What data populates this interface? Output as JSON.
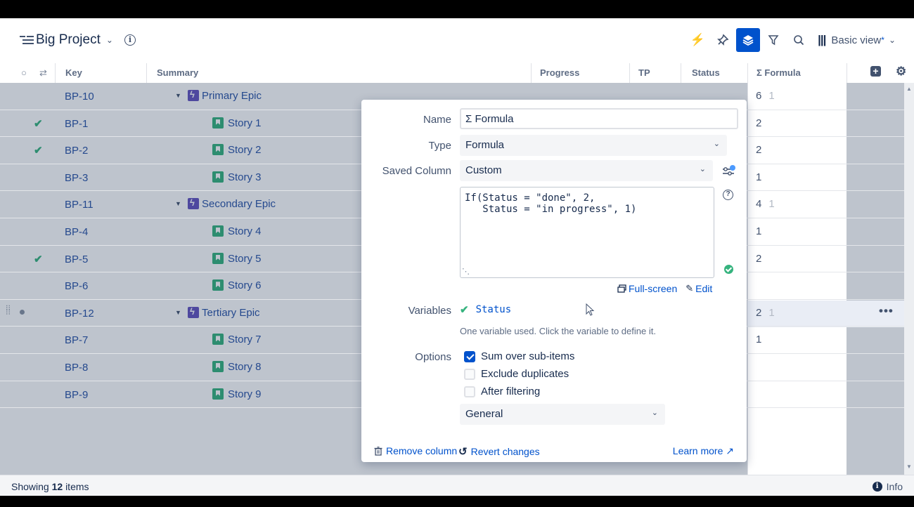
{
  "header": {
    "project_name": "Big Project",
    "view_name": "Basic view",
    "view_modified_marker": "*"
  },
  "columns": {
    "key": "Key",
    "summary": "Summary",
    "progress": "Progress",
    "tp": "TP",
    "status": "Status",
    "formula": "Σ Formula"
  },
  "rows": [
    {
      "key": "BP-10",
      "summary": "Primary Epic",
      "type": "epic",
      "check": false,
      "formula": "6",
      "formula_sub": "1"
    },
    {
      "key": "BP-1",
      "summary": "Story 1",
      "type": "story",
      "check": true,
      "formula": "2",
      "formula_sub": ""
    },
    {
      "key": "BP-2",
      "summary": "Story 2",
      "type": "story",
      "check": true,
      "formula": "2",
      "formula_sub": ""
    },
    {
      "key": "BP-3",
      "summary": "Story 3",
      "type": "story",
      "check": false,
      "formula": "1",
      "formula_sub": ""
    },
    {
      "key": "BP-11",
      "summary": "Secondary Epic",
      "type": "epic",
      "check": false,
      "formula": "4",
      "formula_sub": "1"
    },
    {
      "key": "BP-4",
      "summary": "Story 4",
      "type": "story",
      "check": false,
      "formula": "1",
      "formula_sub": ""
    },
    {
      "key": "BP-5",
      "summary": "Story 5",
      "type": "story",
      "check": true,
      "formula": "2",
      "formula_sub": ""
    },
    {
      "key": "BP-6",
      "summary": "Story 6",
      "type": "story",
      "check": false,
      "formula": "",
      "formula_sub": ""
    },
    {
      "key": "BP-12",
      "summary": "Tertiary Epic",
      "type": "epic",
      "check": false,
      "formula": "2",
      "formula_sub": "1",
      "hovered": true
    },
    {
      "key": "BP-7",
      "summary": "Story 7",
      "type": "story",
      "check": false,
      "formula": "1",
      "formula_sub": ""
    },
    {
      "key": "BP-8",
      "summary": "Story 8",
      "type": "story",
      "check": false,
      "formula": "",
      "formula_sub": ""
    },
    {
      "key": "BP-9",
      "summary": "Story 9",
      "type": "story",
      "check": false,
      "formula": "",
      "formula_sub": ""
    }
  ],
  "dialog": {
    "name_label": "Name",
    "name_value": "Σ Formula",
    "type_label": "Type",
    "type_value": "Formula",
    "saved_label": "Saved Column",
    "saved_value": "Custom",
    "formula_text": "If(Status = \"done\", 2,\n   Status = \"in progress\", 1)",
    "fullscreen_link": "Full-screen",
    "edit_link": "Edit",
    "variables_label": "Variables",
    "variable_name": "Status",
    "variables_hint": "One variable used. Click the variable to define it.",
    "options_label": "Options",
    "options": [
      {
        "label": "Sum over sub-items",
        "checked": true
      },
      {
        "label": "Exclude duplicates",
        "checked": false
      },
      {
        "label": "After filtering",
        "checked": false
      }
    ],
    "format_value": "General",
    "remove_column": "Remove column",
    "revert_changes": "Revert changes",
    "learn_more": "Learn more ↗"
  },
  "footer": {
    "showing_prefix": "Showing",
    "showing_count": "12",
    "showing_suffix": "items",
    "info_label": "Info"
  },
  "colors": {
    "accent": "#0052cc",
    "epic": "#6554c0",
    "story": "#36b37e",
    "check": "#36b37e"
  }
}
